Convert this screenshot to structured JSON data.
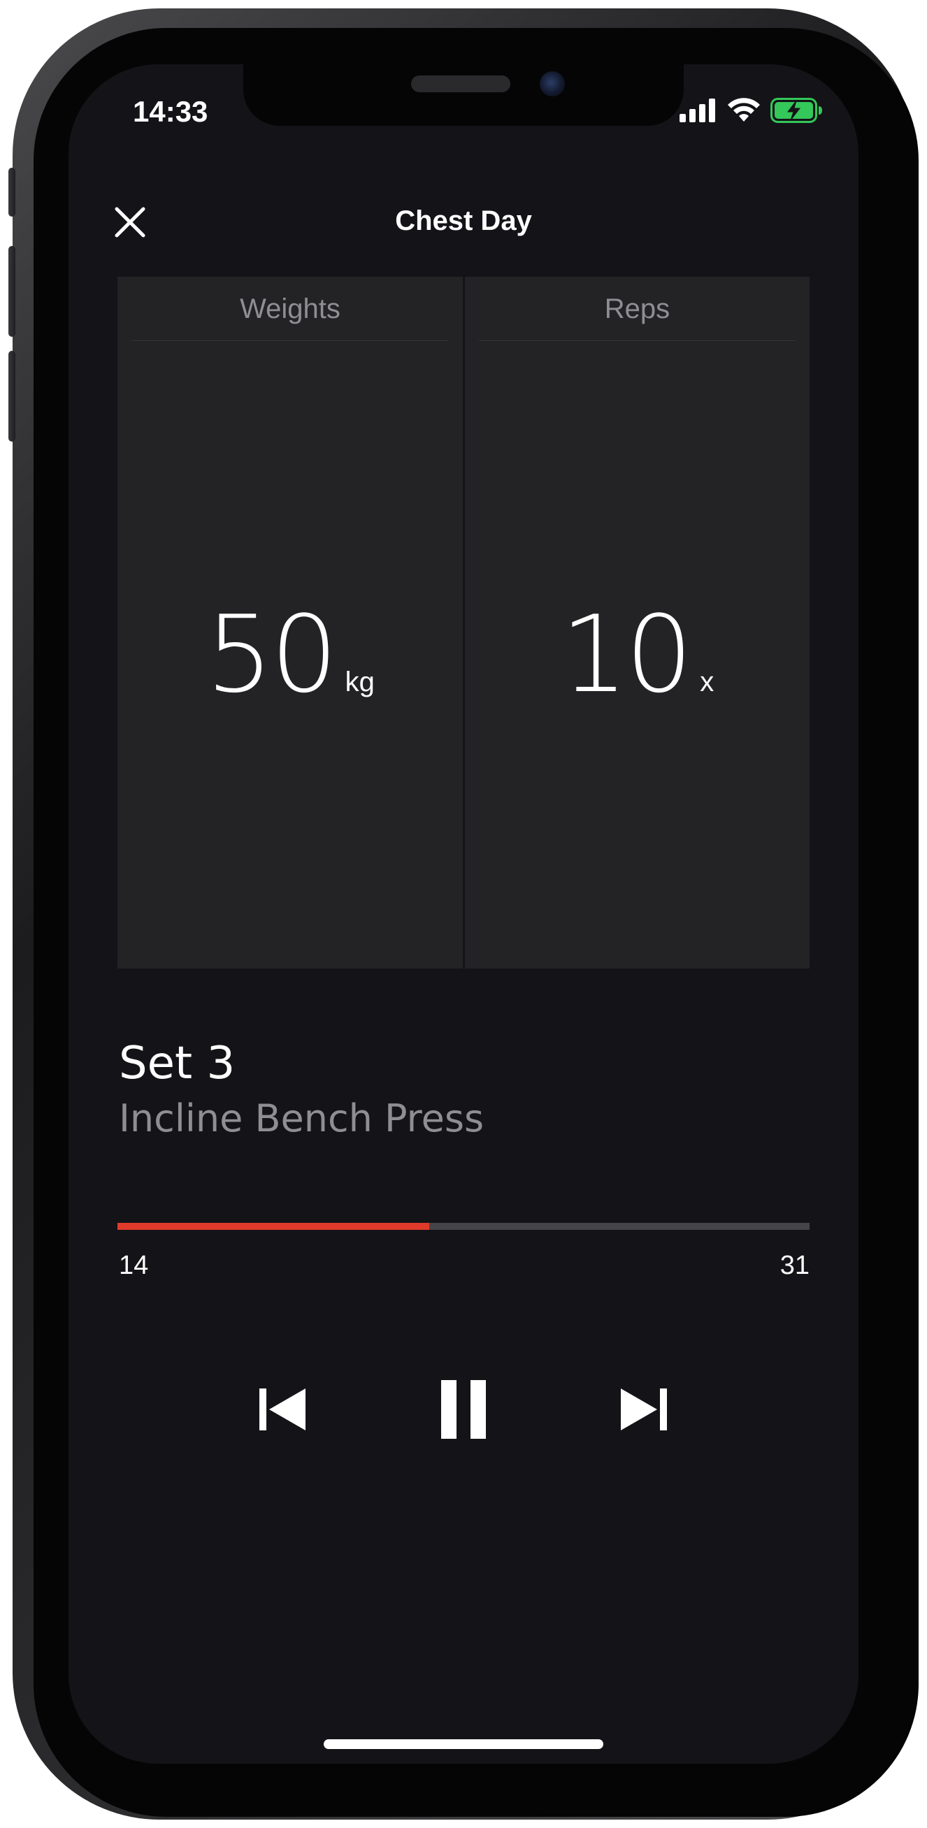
{
  "status_bar": {
    "time": "14:33",
    "icons": [
      "cellular-signal-icon",
      "wifi-icon",
      "battery-charging-icon"
    ],
    "battery_color": "#34c759"
  },
  "nav": {
    "title": "Chest Day",
    "close_icon": "close-icon"
  },
  "stats": {
    "weights": {
      "label": "Weights",
      "value": "50",
      "unit": "kg"
    },
    "reps": {
      "label": "Reps",
      "value": "10",
      "unit": "x"
    }
  },
  "set": {
    "title": "Set 3",
    "exercise": "Incline Bench Press"
  },
  "progress": {
    "start_label": "14",
    "end_label": "31",
    "fraction": 0.45,
    "fill_color": "#e03a2b",
    "track_color": "#454547"
  },
  "controls": {
    "previous_icon": "skip-previous-icon",
    "pause_icon": "pause-icon",
    "next_icon": "skip-next-icon"
  },
  "colors": {
    "background": "#141317",
    "panel": "#232325",
    "accent": "#e03a2b",
    "secondary_text": "#8e8e93"
  }
}
